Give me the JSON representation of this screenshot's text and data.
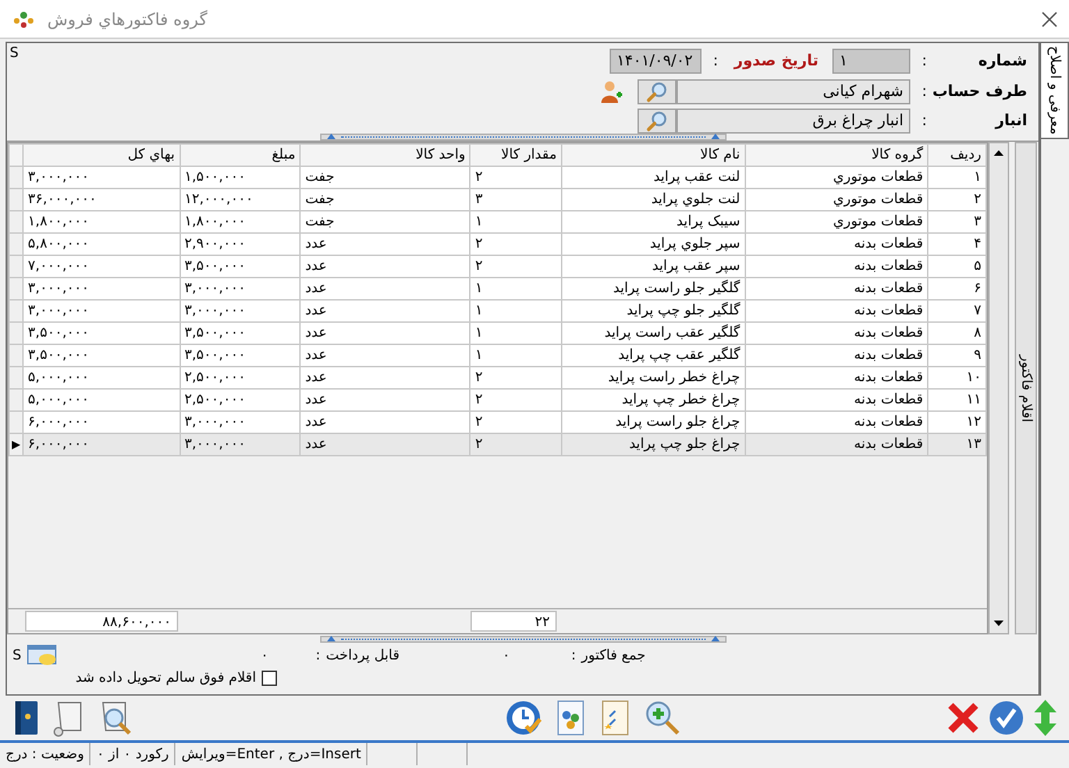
{
  "window": {
    "title": "گروه فاكتورهاي  فروش"
  },
  "side_tab": {
    "label": "معرفی و اصلاح"
  },
  "corner_mark": "S",
  "header": {
    "number": {
      "label": "شماره",
      "separator": ":",
      "value": "۱"
    },
    "date": {
      "label": "تاریخ صدور",
      "separator": ":",
      "value": "۱۴۰۱/۰۹/۰۲"
    },
    "account": {
      "label": "طرف حساب",
      "separator": ":",
      "value": "شهرام کیانی"
    },
    "warehouse": {
      "label": "انبار",
      "separator": ":",
      "value": "انبار چراغ برق"
    }
  },
  "items_tab": {
    "label": "اقلام فاکتور"
  },
  "table": {
    "row_indicator": "▶",
    "columns": [
      "ردیف",
      "گروه کالا",
      "نام کالا",
      "مقدار کالا",
      "واحد کالا",
      "مبلغ",
      "بهاي كل"
    ],
    "rows": [
      {
        "cells": [
          "۱",
          "قطعات موتوري",
          "لنت عقب پرايد",
          "۲",
          "جفت",
          "۱,۵۰۰,۰۰۰",
          "۳,۰۰۰,۰۰۰"
        ],
        "selected": false
      },
      {
        "cells": [
          "۲",
          "قطعات موتوري",
          "لنت جلوي پرايد",
          "۳",
          "جفت",
          "۱۲,۰۰۰,۰۰۰",
          "۳۶,۰۰۰,۰۰۰"
        ],
        "selected": false
      },
      {
        "cells": [
          "۳",
          "قطعات موتوري",
          "سيبک پرايد",
          "۱",
          "جفت",
          "۱,۸۰۰,۰۰۰",
          "۱,۸۰۰,۰۰۰"
        ],
        "selected": false
      },
      {
        "cells": [
          "۴",
          "قطعات بدنه",
          "سپر جلوي پرايد",
          "۲",
          "عدد",
          "۲,۹۰۰,۰۰۰",
          "۵,۸۰۰,۰۰۰"
        ],
        "selected": false
      },
      {
        "cells": [
          "۵",
          "قطعات بدنه",
          "سپر عقب پرايد",
          "۲",
          "عدد",
          "۳,۵۰۰,۰۰۰",
          "۷,۰۰۰,۰۰۰"
        ],
        "selected": false
      },
      {
        "cells": [
          "۶",
          "قطعات بدنه",
          "گلگير جلو راست پرايد",
          "۱",
          "عدد",
          "۳,۰۰۰,۰۰۰",
          "۳,۰۰۰,۰۰۰"
        ],
        "selected": false
      },
      {
        "cells": [
          "۷",
          "قطعات بدنه",
          "گلگير جلو چپ پرايد",
          "۱",
          "عدد",
          "۳,۰۰۰,۰۰۰",
          "۳,۰۰۰,۰۰۰"
        ],
        "selected": false
      },
      {
        "cells": [
          "۸",
          "قطعات بدنه",
          "گلگير عقب راست پرايد",
          "۱",
          "عدد",
          "۳,۵۰۰,۰۰۰",
          "۳,۵۰۰,۰۰۰"
        ],
        "selected": false
      },
      {
        "cells": [
          "۹",
          "قطعات بدنه",
          "گلگير عقب چپ پرايد",
          "۱",
          "عدد",
          "۳,۵۰۰,۰۰۰",
          "۳,۵۰۰,۰۰۰"
        ],
        "selected": false
      },
      {
        "cells": [
          "۱۰",
          "قطعات بدنه",
          "چراغ خطر راست پرايد",
          "۲",
          "عدد",
          "۲,۵۰۰,۰۰۰",
          "۵,۰۰۰,۰۰۰"
        ],
        "selected": false
      },
      {
        "cells": [
          "۱۱",
          "قطعات بدنه",
          "چراغ خطر چپ پرايد",
          "۲",
          "عدد",
          "۲,۵۰۰,۰۰۰",
          "۵,۰۰۰,۰۰۰"
        ],
        "selected": false
      },
      {
        "cells": [
          "۱۲",
          "قطعات بدنه",
          "چراغ جلو راست پرايد",
          "۲",
          "عدد",
          "۳,۰۰۰,۰۰۰",
          "۶,۰۰۰,۰۰۰"
        ],
        "selected": false
      },
      {
        "cells": [
          "۱۳",
          "قطعات بدنه",
          "چراغ جلو چپ پرايد",
          "۲",
          "عدد",
          "۳,۰۰۰,۰۰۰",
          "۶,۰۰۰,۰۰۰"
        ],
        "selected": true
      }
    ],
    "totals": {
      "quantity": "۲۲",
      "total": "۸۸,۶۰۰,۰۰۰"
    }
  },
  "footer": {
    "corner_mark": "S",
    "invoice_sum": {
      "label": "جمع فاکتور",
      "separator": ":",
      "value": "۰"
    },
    "payable": {
      "label": "قابل پرداخت",
      "separator": ":",
      "value": "۰"
    },
    "delivered": {
      "label": "اقلام فوق سالم تحویل داده شد",
      "checked": false
    }
  },
  "status_bar": [
    "Insert=درج , Enter=ویرایش",
    "رکورد ۰ از ۰",
    "وضعیت : درج"
  ]
}
